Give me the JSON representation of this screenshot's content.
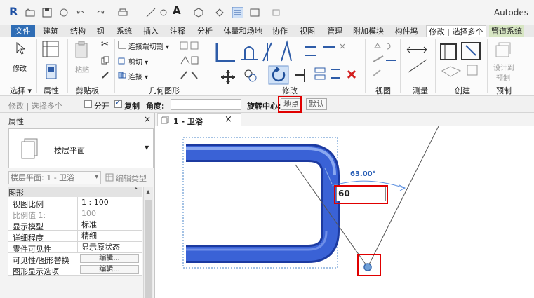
{
  "app": {
    "title": "Autodes"
  },
  "tabs": [
    "文件",
    "建筑",
    "结构",
    "钢",
    "系统",
    "插入",
    "注释",
    "分析",
    "体量和场地",
    "协作",
    "视图",
    "管理",
    "附加模块",
    "构件坞",
    "修改 | 选择多个",
    "管道系统"
  ],
  "ribbon": {
    "select": {
      "modify_label": "修改",
      "group": "选择 ▾"
    },
    "properties": {
      "group": "属性"
    },
    "clipboard": {
      "paste_label": "粘贴",
      "group": "剪贴板"
    },
    "geometry": {
      "cope_label": "连接端切割 ▾",
      "cut_label": "剪切 ▾",
      "join_label": "连接 ▾",
      "group": "几何图形"
    },
    "modify": {
      "group": "修改"
    },
    "view": {
      "group": "视图"
    },
    "measure": {
      "group": "测量"
    },
    "create": {
      "group": "创建"
    },
    "prefab": {
      "design_label": "设计到",
      "prefab_label": "预制",
      "group": "预制"
    }
  },
  "options_bar": {
    "context": "修改 | 选择多个",
    "disjoin_label": "分开",
    "copy_label": "复制",
    "angle_label": "角度:",
    "center_label": "旋转中心:",
    "place_button": "地点",
    "default_button": "默认"
  },
  "properties": {
    "title": "属性",
    "close": "×",
    "type_name": "楼层平面",
    "instance": "楼层平面: 1 - 卫浴",
    "edit_type": "编辑类型",
    "category": "图形",
    "rows": [
      {
        "key": "视图比例",
        "value": "1 : 100"
      },
      {
        "key": "比例值 1:",
        "value": "100"
      },
      {
        "key": "显示模型",
        "value": "标准"
      },
      {
        "key": "详细程度",
        "value": "精细"
      },
      {
        "key": "零件可见性",
        "value": "显示原状态"
      },
      {
        "key": "可见性/图形替换",
        "button": "编辑..."
      },
      {
        "key": "图形显示选项",
        "button": "编辑..."
      }
    ]
  },
  "view_tab": {
    "label": "1 - 卫浴",
    "close": "×"
  },
  "canvas": {
    "angle_text": "63.00°",
    "input_value": "60"
  }
}
